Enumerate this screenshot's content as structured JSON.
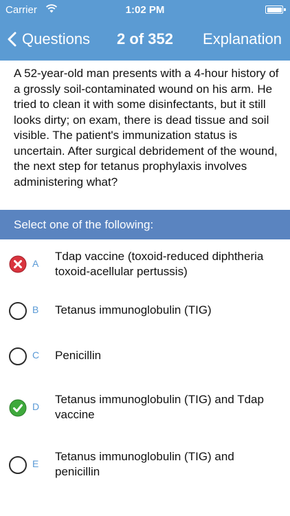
{
  "status_bar": {
    "carrier": "Carrier",
    "time": "1:02 PM"
  },
  "nav": {
    "back_label": "Questions",
    "counter": "2 of 352",
    "right_label": "Explanation"
  },
  "question": {
    "text": "A 52-year-old man presents with a 4-hour history of a grossly soil-contaminated wound on his arm. He tried to clean it with some disinfectants, but it still looks dirty; on exam, there is dead tissue and soil visible. The patient's immunization status is uncertain. After surgical debridement of the wound, the next step for tetanus prophylaxis involves administering what?"
  },
  "select_prompt": "Select one of the following:",
  "answers": [
    {
      "letter": "A",
      "text": "Tdap vaccine (toxoid-reduced diphtheria toxoid-acellular pertussis)",
      "state": "incorrect"
    },
    {
      "letter": "B",
      "text": "Tetanus immunoglobulin (TIG)",
      "state": "none"
    },
    {
      "letter": "C",
      "text": "Penicillin",
      "state": "none"
    },
    {
      "letter": "D",
      "text": "Tetanus immunoglobulin (TIG) and Tdap vaccine",
      "state": "correct"
    },
    {
      "letter": "E",
      "text": "Tetanus immunoglobulin (TIG) and penicillin",
      "state": "none"
    }
  ],
  "colors": {
    "nav_background": "#5b9bd3",
    "select_bar_background": "#5a84c0",
    "incorrect": "#d9343e",
    "correct": "#3fa93c",
    "letter": "#5a9ad6"
  },
  "icons": {
    "wifi": "wifi-icon",
    "battery": "battery-icon",
    "back": "chevron-left-icon",
    "incorrect": "x-circle-icon",
    "correct": "check-circle-icon",
    "unselected": "empty-circle-icon"
  }
}
